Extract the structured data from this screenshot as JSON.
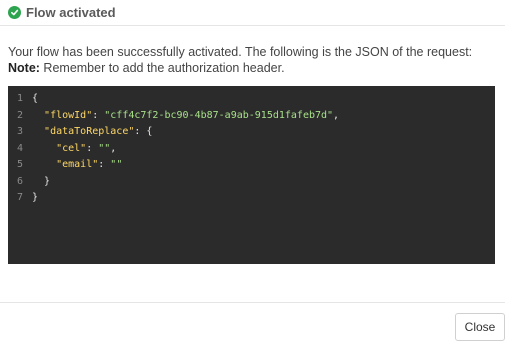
{
  "header": {
    "title": "Flow activated",
    "icon": "check-circle-icon",
    "icon_color": "#2ea44f"
  },
  "body": {
    "description": "Your flow has been successfully activated. The following is the JSON of the request:",
    "note_label": "Note:",
    "note_text": " Remember to add the authorization header."
  },
  "code": {
    "line_numbers": [
      "1",
      "2",
      "3",
      "4",
      "5",
      "6",
      "7"
    ],
    "open_brace": "{",
    "flowId_key": "\"flowId\"",
    "flowId_value": "\"cff4c7f2-bc90-4b87-a9ab-915d1fafeb7d\"",
    "dataToReplace_key": "\"dataToReplace\"",
    "cel_key": "\"cel\"",
    "cel_value": "\"\"",
    "email_key": "\"email\"",
    "email_value": "\"\"",
    "inner_close": "}",
    "outer_close": "}",
    "colon": ": ",
    "comma": ",",
    "inner_open": "{"
  },
  "footer": {
    "close_label": "Close"
  }
}
